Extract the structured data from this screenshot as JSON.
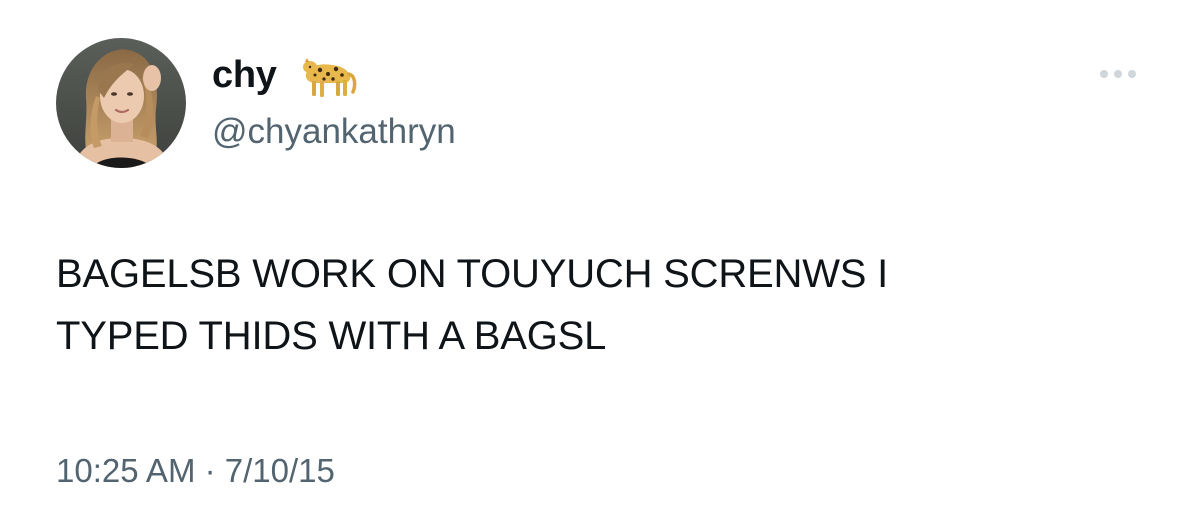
{
  "author": {
    "display_name": "chy",
    "name_emoji": "leopard-emoji",
    "handle": "@chyankathryn"
  },
  "tweet": {
    "text": "BAGELSB WORK ON TOUYUCH SCRENWS I\nTYPED THIDS WITH A BAGSL",
    "time": "10:25 AM",
    "separator": "·",
    "date": "7/10/15"
  },
  "icons": {
    "more": "more-horizontal-icon"
  },
  "colors": {
    "text_primary": "#0f1419",
    "text_secondary": "#536471",
    "more_dots": "#aab8c2",
    "background": "#ffffff"
  }
}
